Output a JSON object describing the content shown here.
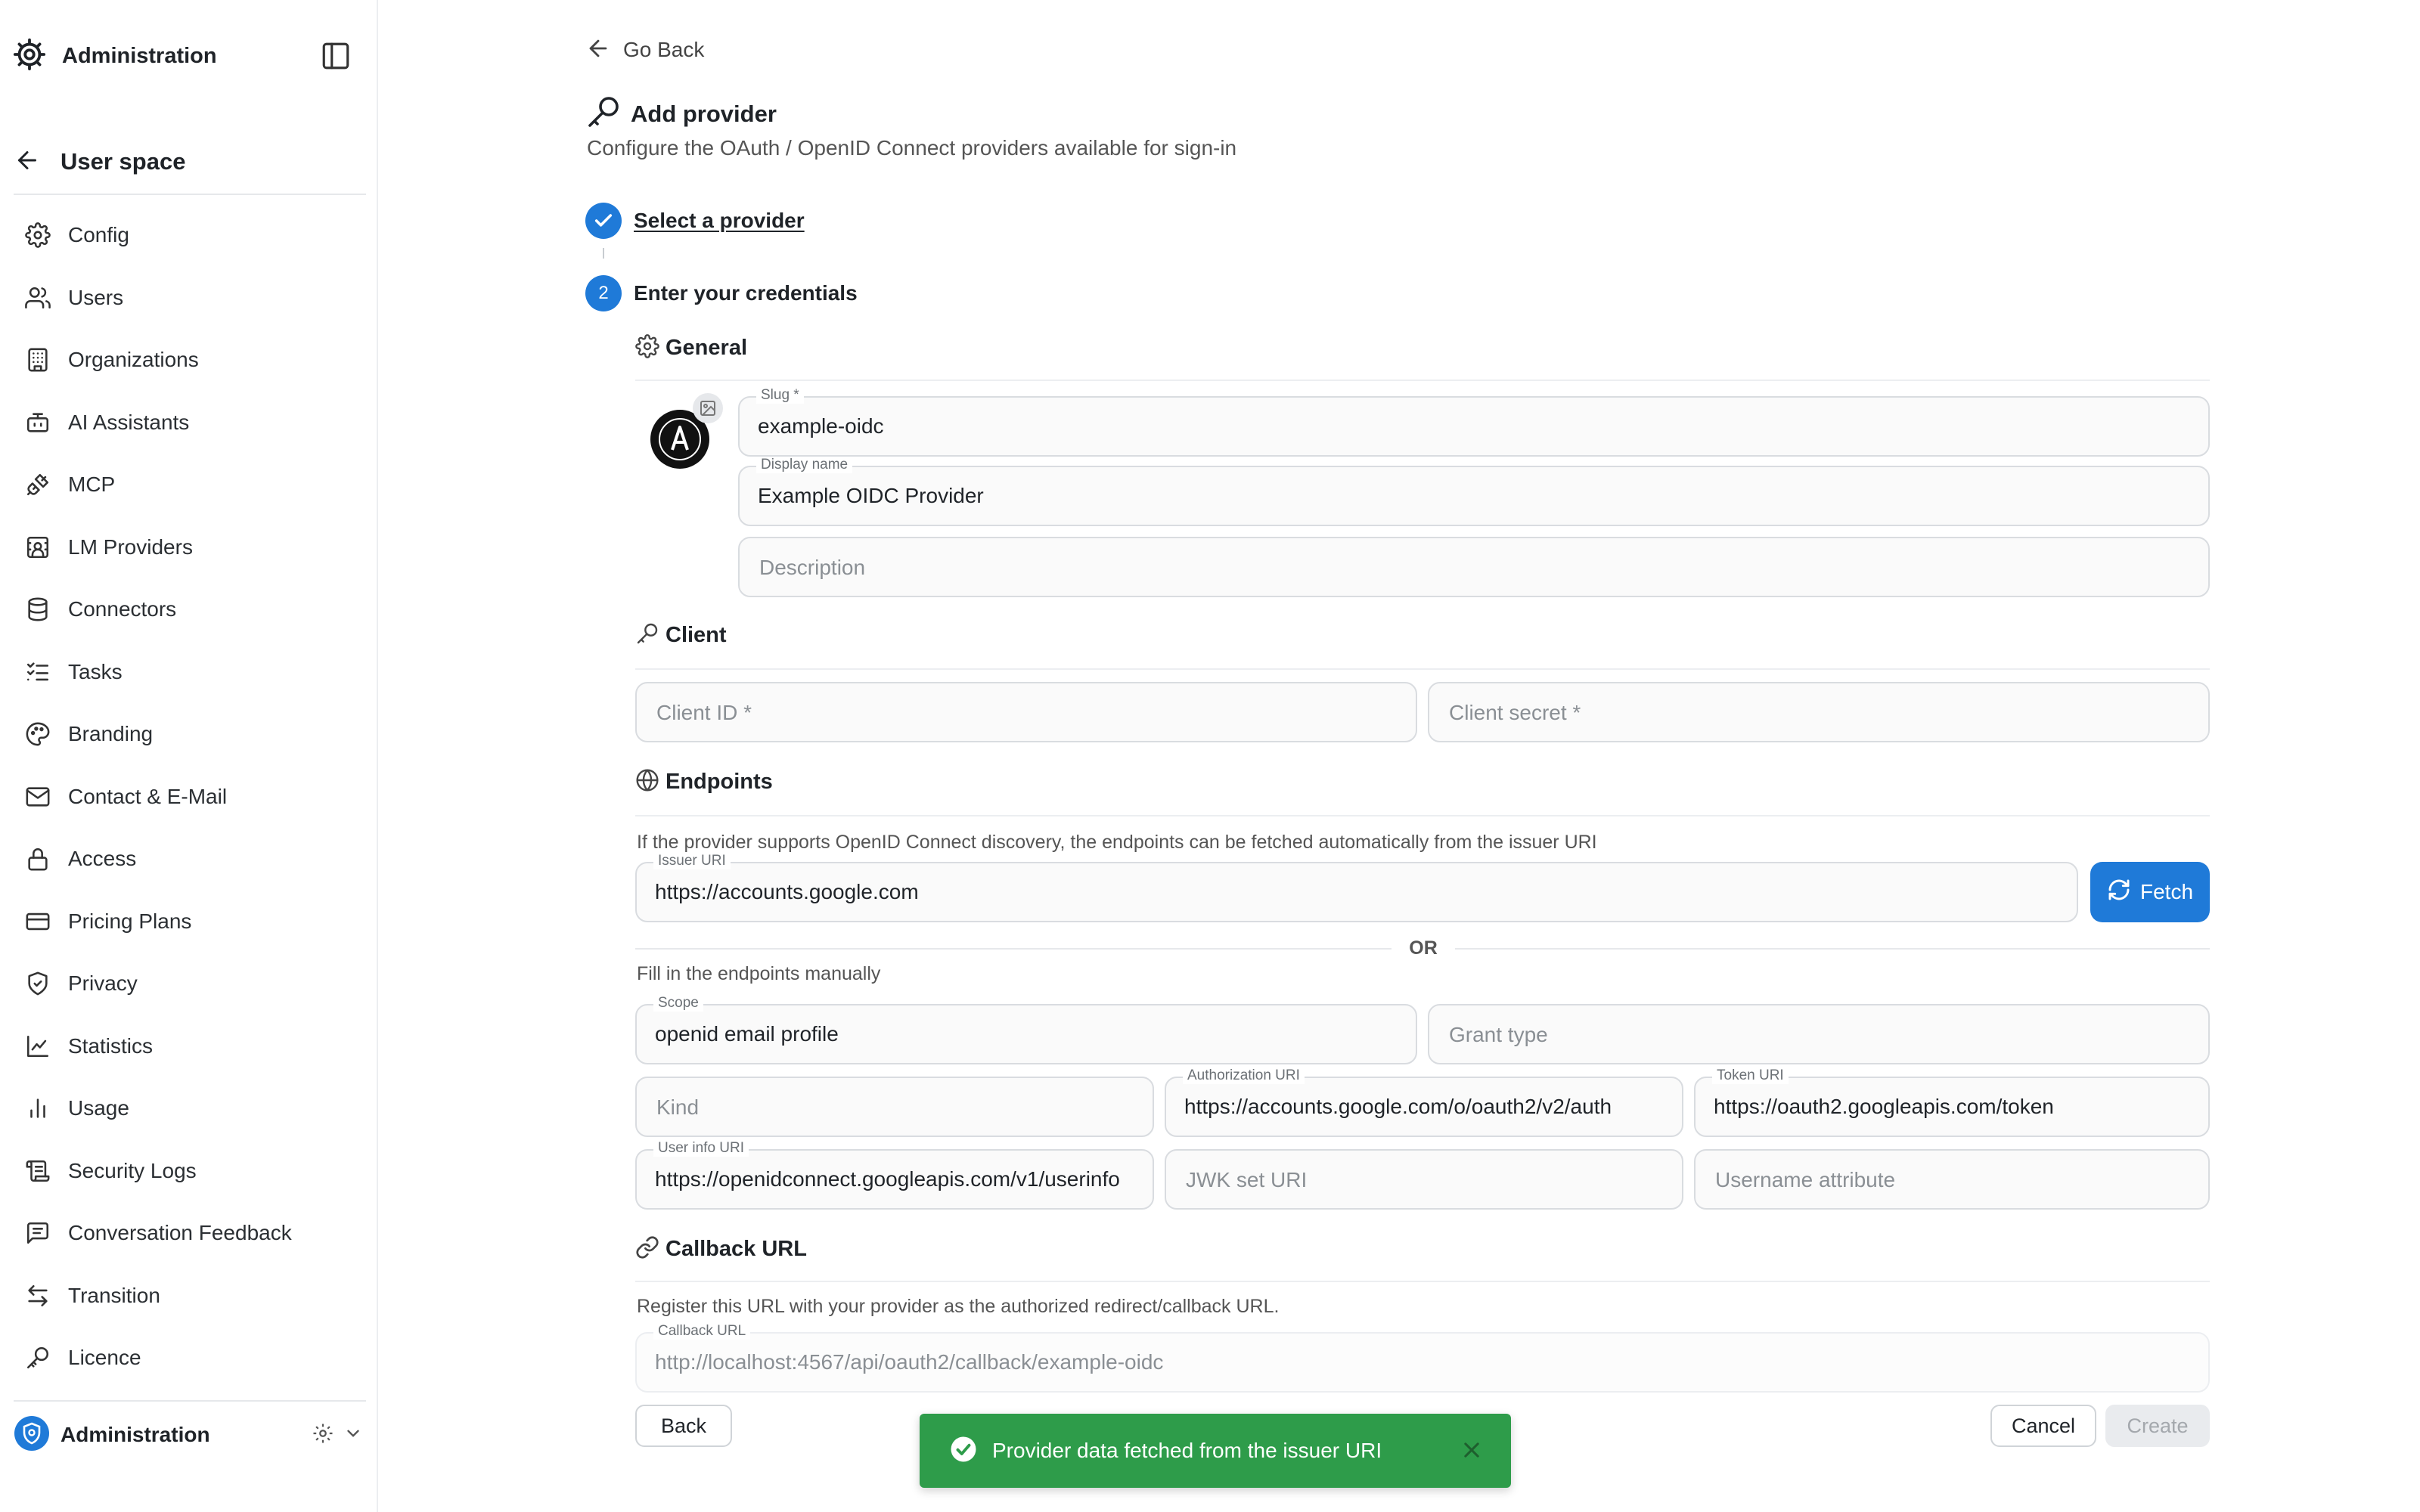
{
  "sidebar": {
    "title": "Administration",
    "back_label": "User space",
    "items": [
      {
        "label": "Config",
        "icon": "gear-icon"
      },
      {
        "label": "Users",
        "icon": "users-icon"
      },
      {
        "label": "Organizations",
        "icon": "building-icon"
      },
      {
        "label": "AI Assistants",
        "icon": "bot-icon"
      },
      {
        "label": "MCP",
        "icon": "plug-icon"
      },
      {
        "label": "LM Providers",
        "icon": "server-icon"
      },
      {
        "label": "Connectors",
        "icon": "database-icon"
      },
      {
        "label": "Tasks",
        "icon": "list-checks-icon"
      },
      {
        "label": "Branding",
        "icon": "palette-icon"
      },
      {
        "label": "Contact & E-Mail",
        "icon": "mail-icon"
      },
      {
        "label": "Access",
        "icon": "lock-icon"
      },
      {
        "label": "Pricing Plans",
        "icon": "credit-card-icon"
      },
      {
        "label": "Privacy",
        "icon": "shield-check-icon"
      },
      {
        "label": "Statistics",
        "icon": "line-chart-icon"
      },
      {
        "label": "Usage",
        "icon": "bar-chart-icon"
      },
      {
        "label": "Security Logs",
        "icon": "scroll-icon"
      },
      {
        "label": "Conversation Feedback",
        "icon": "message-square-icon"
      },
      {
        "label": "Transition",
        "icon": "arrows-left-right-icon"
      },
      {
        "label": "Licence",
        "icon": "key-icon"
      }
    ],
    "footer_label": "Administration"
  },
  "main": {
    "go_back": "Go Back",
    "title": "Add provider",
    "subtitle": "Configure the OAuth / OpenID Connect providers available for sign-in",
    "steps": [
      {
        "number": "",
        "label": "Select a provider"
      },
      {
        "number": "2",
        "label": "Enter your credentials"
      }
    ],
    "general": {
      "heading": "General",
      "slug_label": "Slug *",
      "slug_value": "example-oidc",
      "display_name_label": "Display name",
      "display_name_value": "Example OIDC Provider",
      "description_placeholder": "Description"
    },
    "client": {
      "heading": "Client",
      "client_id_placeholder": "Client ID *",
      "client_secret_placeholder": "Client secret *"
    },
    "endpoints": {
      "heading": "Endpoints",
      "discovery_hint": "If the provider supports OpenID Connect discovery, the endpoints can be fetched automatically from the issuer URI",
      "issuer_label": "Issuer URI",
      "issuer_value": "https://accounts.google.com",
      "fetch_label": "Fetch",
      "or_label": "OR",
      "manual_hint": "Fill in the endpoints manually",
      "scope_label": "Scope",
      "scope_value": "openid email profile",
      "grant_type_placeholder": "Grant type",
      "kind_placeholder": "Kind",
      "authorization_label": "Authorization URI",
      "authorization_value": "https://accounts.google.com/o/oauth2/v2/auth",
      "token_label": "Token URI",
      "token_value": "https://oauth2.googleapis.com/token",
      "userinfo_label": "User info URI",
      "userinfo_value": "https://openidconnect.googleapis.com/v1/userinfo",
      "jwk_placeholder": "JWK set URI",
      "username_attr_placeholder": "Username attribute"
    },
    "callback": {
      "heading": "Callback URL",
      "hint": "Register this URL with your provider as the authorized redirect/callback URL.",
      "label": "Callback URL",
      "value": "http://localhost:4567/api/oauth2/callback/example-oidc"
    },
    "actions": {
      "back": "Back",
      "cancel": "Cancel",
      "create": "Create"
    }
  },
  "toast": {
    "message": "Provider data fetched from the issuer URI"
  },
  "colors": {
    "accent": "#1f7ad8",
    "success": "#2e9c4a"
  }
}
